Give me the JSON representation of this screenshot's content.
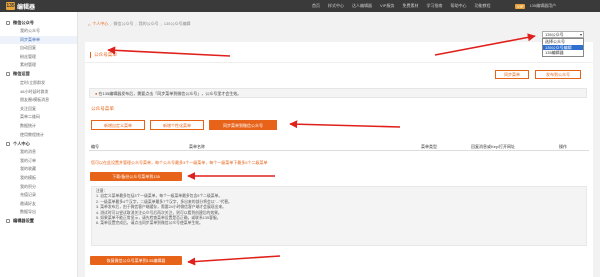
{
  "topbar": {
    "logo_mark": "135",
    "logo_text": "编辑器",
    "nav": [
      "首页",
      "样式中心",
      "达人编辑器",
      "VIP服务",
      "免费素材",
      "学习指南",
      "帮助中心",
      "功能教程"
    ],
    "vip_badge": "VIP",
    "user": "135编辑器用户"
  },
  "sidebar": {
    "groups": [
      {
        "label": "微信公众号",
        "items": [
          "我的公众号",
          "同步菜单单",
          "自动回复",
          "粉丝管理",
          "素材管理"
        ]
      },
      {
        "label": "微信运营",
        "items": [
          "定时/立即群发",
          "48小时延时群发",
          "朋友圈/模板消息",
          "关注回复",
          "菜单二维码",
          "数据统计",
          "使用教程统计"
        ]
      },
      {
        "label": "个人中心",
        "items": [
          "我的消息",
          "我的订单",
          "我的收藏",
          "我的模板",
          "我的积分",
          "充值记录",
          "邀请好友",
          "数据导出"
        ]
      },
      {
        "label": "编辑器设置",
        "items": []
      }
    ],
    "active": "同步菜单单"
  },
  "breadcrumb": [
    "个人中心",
    "微信公众号",
    "我的公众号",
    "135公众号编辑"
  ],
  "account_select": {
    "value": "135公众号",
    "options": [
      "选择公众号",
      "135公众号编辑",
      "135编辑器"
    ]
  },
  "panel": {
    "title": "公众号菜单",
    "btn_sync": "同步菜单",
    "btn_publish": "发布到公众号",
    "notice_pre": "在135编辑器发布后，需要点击「同步菜单到微信公众号」，公众号里才会生效。",
    "gen_title": "公众号菜单",
    "tabs": [
      "新增自定义菜单",
      "新增个性化菜单",
      "同步菜单到微信公众号"
    ],
    "columns": [
      "编号",
      "菜单名称",
      "菜单类型",
      "回复消息或Key/打开网址",
      "操作"
    ],
    "hint": "您可以在此设置并管理公众号菜单，每个公众号最多3个一级菜单，每个一级菜单下最多5个二级菜单",
    "gen_button": "下载/备份公众号菜单到135",
    "rules": [
      "注意：",
      "1. 自定义菜单最多包括3个一级菜单，每个一级菜单最多包含5个二级菜单。",
      "2. 一级菜单最多4个汉字，二级菜单最多7个汉字，多出来的部分将会以\"...\"代替。",
      "3. 菜单发布后，由于微信客户端缓存，需要24小时微信客户端才会展现出来。",
      "4. 测试时可以尝试取消关注公众号后再次关注，则可以看到创建后的效果。",
      "5. 如果菜单不能正常显示，请先检查菜单设置是否正确，或联系135客服。",
      "6. 菜单设置完成后，请点击同步菜单到微信公众号使菜单生效。"
    ],
    "restore_button": "恢复微信公众号菜单到135编辑器"
  },
  "colors": {
    "accent": "#e8631a",
    "arrow": "#e0201b",
    "select_highlight": "#2f6fce"
  }
}
